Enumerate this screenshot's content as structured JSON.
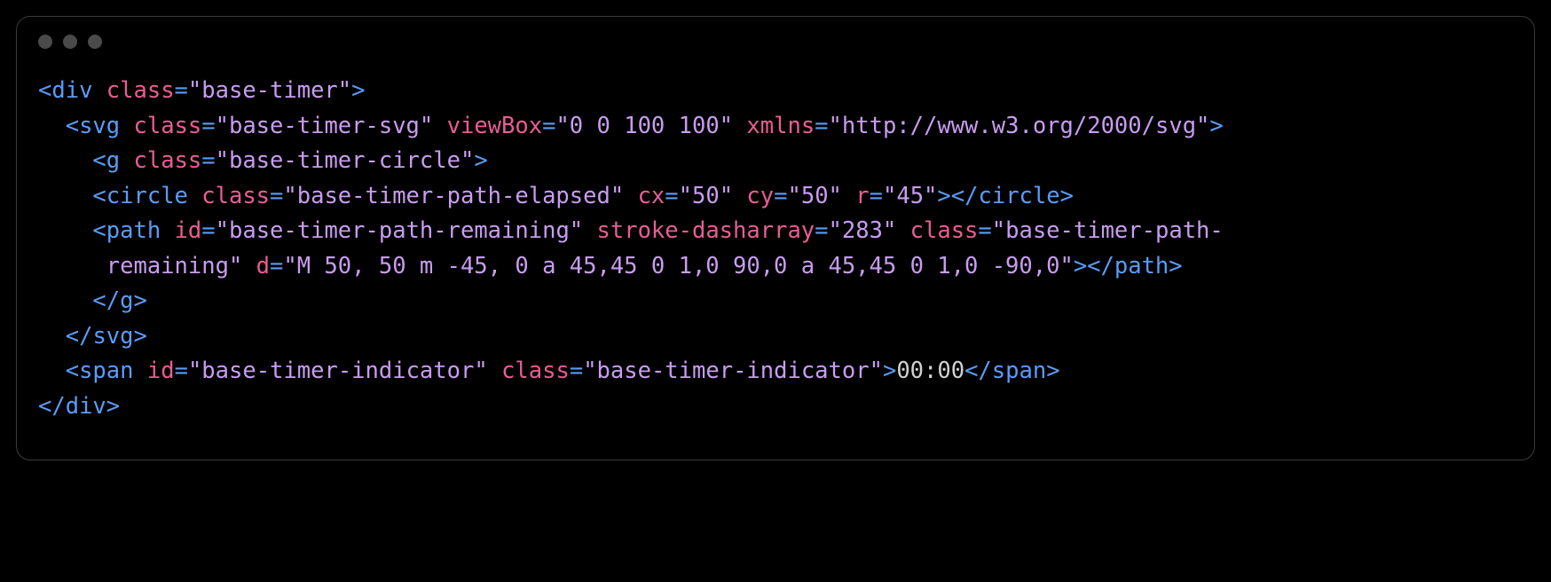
{
  "code": {
    "tokens": [
      [
        {
          "t": "punct",
          "v": "<"
        },
        {
          "t": "tag",
          "v": "div"
        },
        {
          "t": "text",
          "v": " "
        },
        {
          "t": "attr-name",
          "v": "class"
        },
        {
          "t": "punct",
          "v": "="
        },
        {
          "t": "attr-value",
          "v": "\"base-timer\""
        },
        {
          "t": "punct",
          "v": ">"
        }
      ],
      [
        {
          "t": "text",
          "v": "  "
        },
        {
          "t": "punct",
          "v": "<"
        },
        {
          "t": "tag",
          "v": "svg"
        },
        {
          "t": "text",
          "v": " "
        },
        {
          "t": "attr-name",
          "v": "class"
        },
        {
          "t": "punct",
          "v": "="
        },
        {
          "t": "attr-value",
          "v": "\"base-timer-svg\""
        },
        {
          "t": "text",
          "v": " "
        },
        {
          "t": "attr-name",
          "v": "viewBox"
        },
        {
          "t": "punct",
          "v": "="
        },
        {
          "t": "attr-value",
          "v": "\"0 0 100 100\""
        },
        {
          "t": "text",
          "v": " "
        },
        {
          "t": "attr-name",
          "v": "xmlns"
        },
        {
          "t": "punct",
          "v": "="
        },
        {
          "t": "attr-value",
          "v": "\"http://www.w3.org/2000/svg\""
        },
        {
          "t": "punct",
          "v": ">"
        }
      ],
      [
        {
          "t": "text",
          "v": "    "
        },
        {
          "t": "punct",
          "v": "<"
        },
        {
          "t": "tag",
          "v": "g"
        },
        {
          "t": "text",
          "v": " "
        },
        {
          "t": "attr-name",
          "v": "class"
        },
        {
          "t": "punct",
          "v": "="
        },
        {
          "t": "attr-value",
          "v": "\"base-timer-circle\""
        },
        {
          "t": "punct",
          "v": ">"
        }
      ],
      [
        {
          "t": "text",
          "v": "    "
        },
        {
          "t": "punct",
          "v": "<"
        },
        {
          "t": "tag",
          "v": "circle"
        },
        {
          "t": "text",
          "v": " "
        },
        {
          "t": "attr-name",
          "v": "class"
        },
        {
          "t": "punct",
          "v": "="
        },
        {
          "t": "attr-value",
          "v": "\"base-timer-path-elapsed\""
        },
        {
          "t": "text",
          "v": " "
        },
        {
          "t": "attr-name",
          "v": "cx"
        },
        {
          "t": "punct",
          "v": "="
        },
        {
          "t": "attr-value",
          "v": "\"50\""
        },
        {
          "t": "text",
          "v": " "
        },
        {
          "t": "attr-name",
          "v": "cy"
        },
        {
          "t": "punct",
          "v": "="
        },
        {
          "t": "attr-value",
          "v": "\"50\""
        },
        {
          "t": "text",
          "v": " "
        },
        {
          "t": "attr-name",
          "v": "r"
        },
        {
          "t": "punct",
          "v": "="
        },
        {
          "t": "attr-value",
          "v": "\"45\""
        },
        {
          "t": "punct",
          "v": "></"
        },
        {
          "t": "tag",
          "v": "circle"
        },
        {
          "t": "punct",
          "v": ">"
        }
      ],
      [
        {
          "t": "text",
          "v": "    "
        },
        {
          "t": "punct",
          "v": "<"
        },
        {
          "t": "tag",
          "v": "path"
        },
        {
          "t": "text",
          "v": " "
        },
        {
          "t": "attr-name",
          "v": "id"
        },
        {
          "t": "punct",
          "v": "="
        },
        {
          "t": "attr-value",
          "v": "\"base-timer-path-remaining\""
        },
        {
          "t": "text",
          "v": " "
        },
        {
          "t": "attr-name",
          "v": "stroke-dasharray"
        },
        {
          "t": "punct",
          "v": "="
        },
        {
          "t": "attr-value",
          "v": "\"283\""
        },
        {
          "t": "text",
          "v": " "
        },
        {
          "t": "attr-name",
          "v": "class"
        },
        {
          "t": "punct",
          "v": "="
        },
        {
          "t": "attr-value",
          "v": "\"base-timer-path-"
        }
      ],
      [
        {
          "t": "attr-value",
          "v": "     remaining\""
        },
        {
          "t": "text",
          "v": " "
        },
        {
          "t": "attr-name",
          "v": "d"
        },
        {
          "t": "punct",
          "v": "="
        },
        {
          "t": "attr-value",
          "v": "\"M 50, 50 m -45, 0 a 45,45 0 1,0 90,0 a 45,45 0 1,0 -90,0\""
        },
        {
          "t": "punct",
          "v": "></"
        },
        {
          "t": "tag",
          "v": "path"
        },
        {
          "t": "punct",
          "v": ">"
        }
      ],
      [
        {
          "t": "text",
          "v": "    "
        },
        {
          "t": "punct",
          "v": "</"
        },
        {
          "t": "tag",
          "v": "g"
        },
        {
          "t": "punct",
          "v": ">"
        }
      ],
      [
        {
          "t": "text",
          "v": "  "
        },
        {
          "t": "punct",
          "v": "</"
        },
        {
          "t": "tag",
          "v": "svg"
        },
        {
          "t": "punct",
          "v": ">"
        }
      ],
      [
        {
          "t": "text",
          "v": "  "
        },
        {
          "t": "punct",
          "v": "<"
        },
        {
          "t": "tag",
          "v": "span"
        },
        {
          "t": "text",
          "v": " "
        },
        {
          "t": "attr-name",
          "v": "id"
        },
        {
          "t": "punct",
          "v": "="
        },
        {
          "t": "attr-value",
          "v": "\"base-timer-indicator\""
        },
        {
          "t": "text",
          "v": " "
        },
        {
          "t": "attr-name",
          "v": "class"
        },
        {
          "t": "punct",
          "v": "="
        },
        {
          "t": "attr-value",
          "v": "\"base-timer-indicator\""
        },
        {
          "t": "punct",
          "v": ">"
        },
        {
          "t": "text",
          "v": "00:00"
        },
        {
          "t": "punct",
          "v": "</"
        },
        {
          "t": "tag",
          "v": "span"
        },
        {
          "t": "punct",
          "v": ">"
        }
      ],
      [
        {
          "t": "punct",
          "v": "</"
        },
        {
          "t": "tag",
          "v": "div"
        },
        {
          "t": "punct",
          "v": ">"
        }
      ]
    ]
  }
}
